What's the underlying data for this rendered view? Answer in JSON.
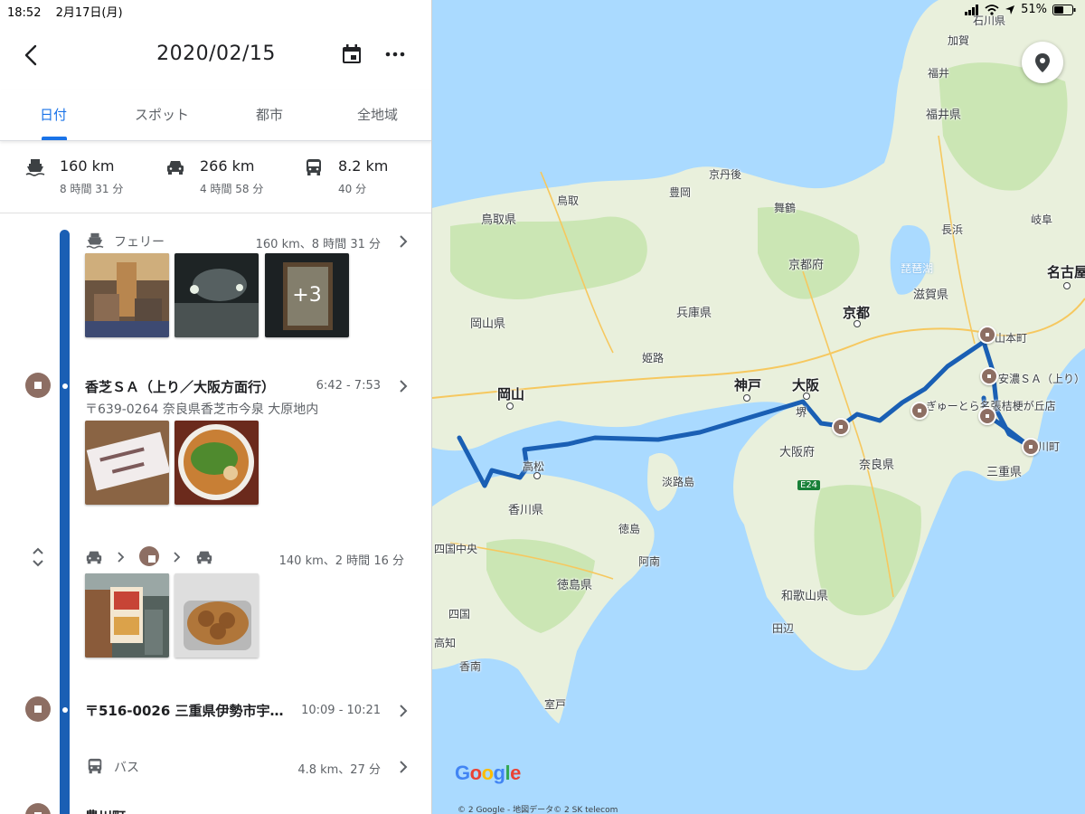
{
  "status": {
    "time": "18:52",
    "date": "2月17日(月)",
    "battery": "51%"
  },
  "header": {
    "title": "2020/02/15"
  },
  "tabs": [
    {
      "label": "日付"
    },
    {
      "label": "スポット"
    },
    {
      "label": "都市"
    },
    {
      "label": "全地域"
    }
  ],
  "summary": [
    {
      "icon": "ferry-icon",
      "distance": "160 km",
      "duration": "8 時間 31 分"
    },
    {
      "icon": "car-icon",
      "distance": "266 km",
      "duration": "4 時間 58 分"
    },
    {
      "icon": "bus-icon",
      "distance": "8.2 km",
      "duration": "40 分"
    }
  ],
  "timeline": {
    "ferry": {
      "label": "フェリー",
      "meta": "160 km、8 時間 31 分",
      "more_photos": "+3"
    },
    "place1": {
      "title": "香芝ＳＡ（上り／大阪方面行）",
      "time": "6:42 - 7:53",
      "address": "〒639-0264 奈良県香芝市今泉 大原地内"
    },
    "drive": {
      "meta": "140 km、2 時間 16 分"
    },
    "place2": {
      "title": "〒516-0026 三重県伊勢市宇…",
      "time": "10:09 - 10:21"
    },
    "bus": {
      "label": "バス",
      "meta": "4.8 km、27 分"
    },
    "place3": {
      "title": "豊川町"
    }
  },
  "map": {
    "labels": {
      "ishikawa": "石川県",
      "kaga": "加賀",
      "fukui": "福井",
      "fukuiken": "福井県",
      "kyotango": "京丹後",
      "toyooka": "豊岡",
      "tottori": "鳥取",
      "tottoriken": "鳥取県",
      "maizuru": "舞鶴",
      "nagahama": "長浜",
      "gifu": "岐阜",
      "nagoya": "名古屋",
      "biwako": "琵琶湖",
      "kyotofu": "京都府",
      "shiga": "滋賀県",
      "hyogo": "兵庫県",
      "okayamaken": "岡山県",
      "kyoto": "京都",
      "himeji": "姫路",
      "kobe": "神戸",
      "osaka": "大阪",
      "sakai": "堺",
      "osakafu": "大阪府",
      "nara": "奈良県",
      "okayama": "岡山",
      "takamatsu": "高松",
      "kagawa": "香川県",
      "awaji": "淡路島",
      "tokushima": "徳島",
      "tokushimaken": "徳島県",
      "anan": "阿南",
      "wakayama": "和歌山県",
      "tanabe": "田辺",
      "mie": "三重県",
      "yamamoto": "山本町",
      "anno_sa": "安濃ＳＡ（上り）",
      "gyutoro": "ぎゅーとら名張桔梗が丘店",
      "toyokawa": "豊川町",
      "shikoku_chuo": "四国中央",
      "shikoku": "四国",
      "kochi": "高知",
      "kami": "香南",
      "muroto": "室戸",
      "e24": "E24"
    },
    "copyright": "© 2 Google - 地図データ© 2 SK telecom",
    "logo": "Google"
  },
  "colors": {
    "accent": "#1a73e8",
    "route": "#1a5fb4",
    "marker": "#8d6e63",
    "water": "#aadaff",
    "land": "#e9f0dc"
  }
}
